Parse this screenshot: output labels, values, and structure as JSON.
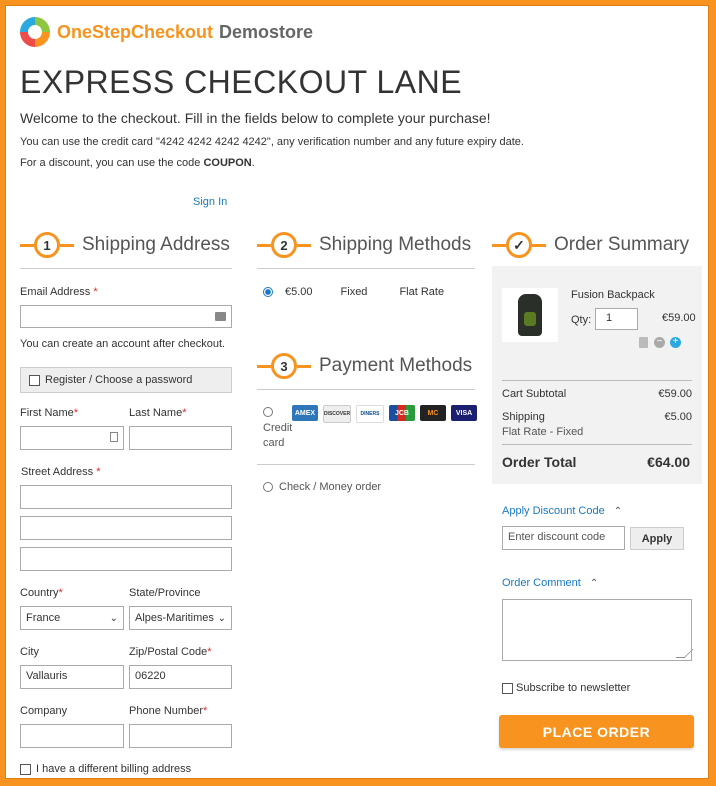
{
  "store": {
    "brand_a": "OneStepCheckout",
    "brand_b": "Demostore"
  },
  "title": "EXPRESS CHECKOUT LANE",
  "welcome": "Welcome to the checkout. Fill in the fields below to complete your purchase!",
  "note_card": "You can use the credit card \"4242 4242 4242 4242\", any verification number and any future expiry date.",
  "note_discount_prefix": "For a discount, you can use the code ",
  "note_discount_code": "COUPON",
  "note_discount_suffix": ".",
  "sign_in": "Sign In",
  "shipping_address": {
    "step": "1",
    "title": "Shipping Address",
    "email_label": "Email Address",
    "email_value": "",
    "account_note": "You can create an account after checkout.",
    "register_label": "Register / Choose a password",
    "first_name_label": "First Name",
    "last_name_label": "Last Name",
    "street_label": "Street Address",
    "country_label": "Country",
    "country_value": "France",
    "state_label": "State/Province",
    "state_value": "Alpes-Maritimes",
    "city_label": "City",
    "city_value": "Vallauris",
    "zip_label": "Zip/Postal Code",
    "zip_value": "06220",
    "company_label": "Company",
    "phone_label": "Phone Number",
    "billing_label": "I have a different billing address",
    "required_mark": "*"
  },
  "shipping_methods": {
    "step": "2",
    "title": "Shipping Methods",
    "price": "€5.00",
    "type": "Fixed",
    "carrier": "Flat Rate"
  },
  "payment_methods": {
    "step": "3",
    "title": "Payment Methods",
    "credit_label_1": "Credit",
    "credit_label_2": "card",
    "cards": [
      "AMEX",
      "DISCOVER",
      "DINERS",
      "JCB",
      "MC",
      "VISA"
    ],
    "check_label": "Check / Money order"
  },
  "order_summary": {
    "step": "✓",
    "title": "Order Summary",
    "product_name": "Fusion Backpack",
    "qty_label": "Qty:",
    "qty_value": "1",
    "product_price": "€59.00",
    "subtotal_label": "Cart Subtotal",
    "subtotal_value": "€59.00",
    "shipping_label": "Shipping",
    "shipping_value": "€5.00",
    "shipping_method": "Flat Rate - Fixed",
    "total_label": "Order Total",
    "total_value": "€64.00"
  },
  "discount": {
    "toggle_label": "Apply Discount Code",
    "placeholder": "Enter discount code",
    "apply_label": "Apply"
  },
  "comment": {
    "toggle_label": "Order Comment"
  },
  "newsletter_label": "Subscribe to newsletter",
  "place_order": "PLACE ORDER",
  "colors": {
    "accent": "#f7931e",
    "link": "#1979c3",
    "required": "#e02b27"
  }
}
